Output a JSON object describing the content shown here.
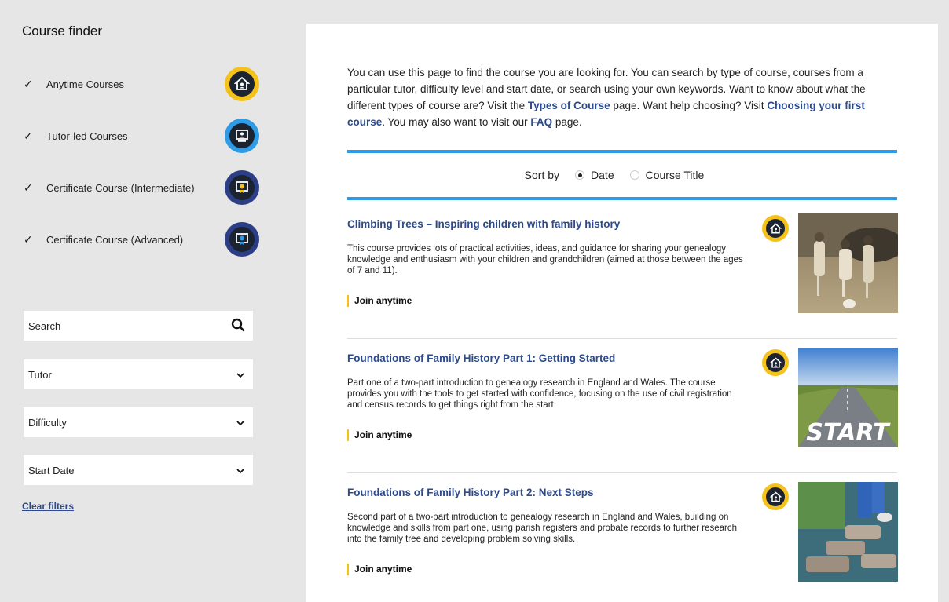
{
  "sidebar": {
    "title": "Course finder",
    "filters": [
      {
        "label": "Anytime Courses",
        "checked": "✓",
        "icon": "anytime-course-icon",
        "ring": "#f4c21b"
      },
      {
        "label": "Tutor-led Courses",
        "checked": "✓",
        "icon": "tutor-led-icon",
        "ring": "#2e9be6"
      },
      {
        "label": "Certificate Course (Intermediate)",
        "checked": "✓",
        "icon": "certificate-intermediate-icon",
        "ring": "#2c3f86"
      },
      {
        "label": "Certificate Course (Advanced)",
        "checked": "✓",
        "icon": "certificate-advanced-icon",
        "ring": "#2c3f86"
      }
    ],
    "search_placeholder": "Search",
    "tutor_label": "Tutor",
    "difficulty_label": "Difficulty",
    "start_date_label": "Start Date",
    "clear_filters": "Clear filters"
  },
  "intro": {
    "part1": "You can use this page to find the course you are looking for. You can search by type of course, courses from a particular tutor, difficulty level and start date, or search using your own keywords. Want to know about what the different types of course are? Visit the ",
    "link1": "Types of Course",
    "part2": " page. Want help choosing? Visit ",
    "link2": "Choosing your first course",
    "part3": ". You may also want to visit our ",
    "link3": "FAQ",
    "part4": " page."
  },
  "sort": {
    "label": "Sort by",
    "option_date": "Date",
    "option_title": "Course Title",
    "selected": "Date"
  },
  "courses": [
    {
      "title": "Climbing Trees – Inspiring children with family history",
      "description": "This course provides lots of practical activities, ideas, and guidance for sharing your genealogy knowledge and enthusiasm with your children and grandchildren (aimed at those between the ages of 7 and 11).",
      "join": "Join anytime"
    },
    {
      "title": "Foundations of Family History Part 1: Getting Started",
      "description": "Part one of a two-part introduction to genealogy research in England and Wales. The course provides you with the tools to get started with confidence, focusing on the use of civil registration and census records to get things right from the start.",
      "join": "Join anytime",
      "thumb_text": "START"
    },
    {
      "title": "Foundations of Family History Part 2: Next Steps",
      "description": "Second part of a two-part introduction to genealogy research in England and Wales, building on knowledge and skills from part one, using parish registers and probate records to further research into the family tree and developing problem solving skills.",
      "join": "Join anytime"
    }
  ],
  "colors": {
    "accent_blue": "#2e9be6",
    "link_blue": "#2c4a8c",
    "badge_yellow": "#f4c21b",
    "badge_dark": "#1c2331"
  }
}
